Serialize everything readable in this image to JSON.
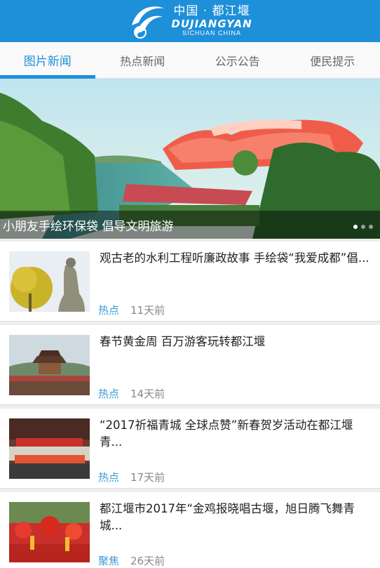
{
  "header": {
    "title_cn": "中国 · 都江堰",
    "title_en": "DUJIANGYAN",
    "subtitle": "SICHUAN CHINA",
    "logo_icon": "dujiangyan-logo-icon"
  },
  "tabs": [
    {
      "label": "图片新闻",
      "active": true
    },
    {
      "label": "热点新闻",
      "active": false
    },
    {
      "label": "公示公告",
      "active": false
    },
    {
      "label": "便民提示",
      "active": false
    }
  ],
  "banner": {
    "caption": "小朋友手绘环保袋 倡导文明旅游",
    "slide_count": 3,
    "active_slide": 1
  },
  "news": [
    {
      "title": "观古老的水利工程听廉政故事 手绘袋“我爱成都”倡...",
      "tag": "热点",
      "time": "11天前"
    },
    {
      "title": "春节黄金周 百万游客玩转都江堰",
      "tag": "热点",
      "time": "14天前"
    },
    {
      "title": "“2017祈福青城 全球点赞”新春贺岁活动在都江堰青...",
      "tag": "热点",
      "time": "17天前"
    },
    {
      "title": "都江堰市2017年“金鸡报晓唱古堰，旭日腾飞舞青城...",
      "tag": "聚焦",
      "time": "26天前"
    }
  ],
  "colors": {
    "brand": "#1e8fd9",
    "tag": "#3b9ad8"
  }
}
